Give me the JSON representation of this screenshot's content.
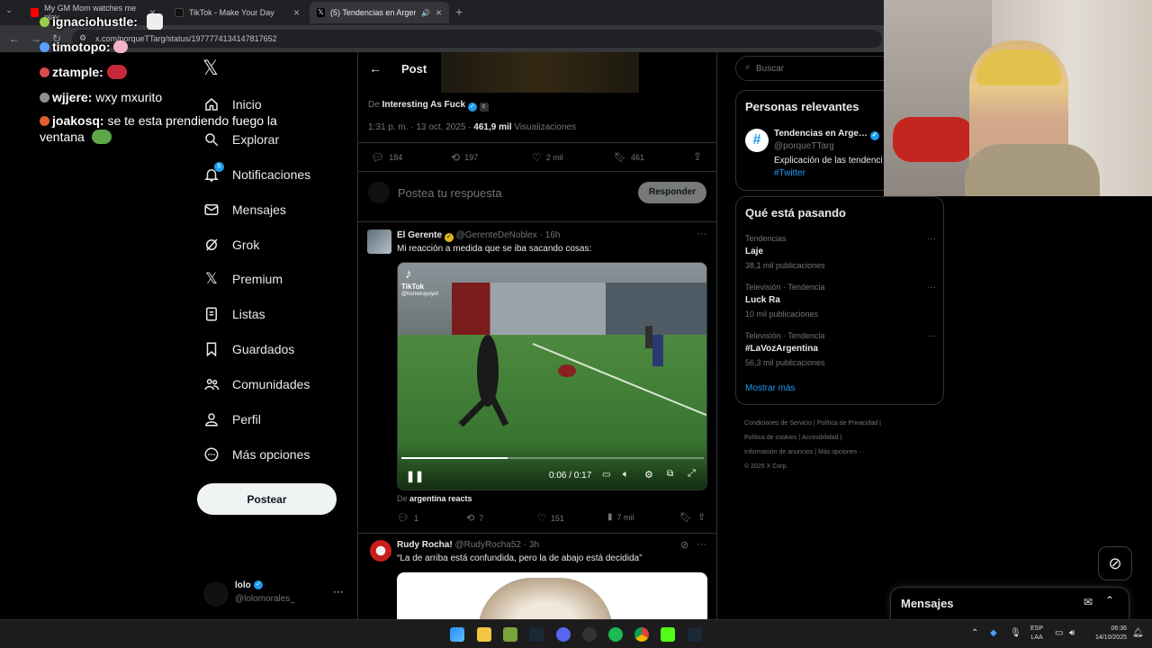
{
  "browser": {
    "tabs": [
      {
        "title": "My GM Mom watches me play",
        "active": false
      },
      {
        "title": "TikTok - Make Your Day",
        "active": false
      },
      {
        "title": "(5) Tendencias en Argentina",
        "active": true
      }
    ],
    "url": "x.com/porqueTTarg/status/1977774134147817652"
  },
  "chat": [
    {
      "user": "ignaciohustle:",
      "msg": "",
      "color": "#9ad14b"
    },
    {
      "user": "timotopo:",
      "msg": "",
      "color": "#5aa0ff"
    },
    {
      "user": "ztample:",
      "msg": "",
      "color": "#d94a4a"
    },
    {
      "user": "wjjere:",
      "msg": "wxy mxurito",
      "color": "#8f8f8f"
    },
    {
      "user": "joakosq:",
      "msg": "se te esta prendiendo fuego la",
      "msg2": "ventana",
      "color": "#e0612b"
    }
  ],
  "nav": {
    "logo": "X",
    "items": [
      {
        "label": "Inicio",
        "icon": "home-icon"
      },
      {
        "label": "Explorar",
        "icon": "search-icon"
      },
      {
        "label": "Notificaciones",
        "icon": "bell-icon",
        "badge": "5"
      },
      {
        "label": "Mensajes",
        "icon": "mail-icon"
      },
      {
        "label": "Grok",
        "icon": "grok-icon"
      },
      {
        "label": "Premium",
        "icon": "x-icon"
      },
      {
        "label": "Listas",
        "icon": "list-icon"
      },
      {
        "label": "Guardados",
        "icon": "bookmark-icon"
      },
      {
        "label": "Comunidades",
        "icon": "people-icon"
      },
      {
        "label": "Perfil",
        "icon": "person-icon"
      },
      {
        "label": "Más opciones",
        "icon": "more-circle-icon"
      }
    ],
    "post_button": "Postear",
    "account": {
      "name": "lolo",
      "handle": "@lolomorales_"
    }
  },
  "post": {
    "header": "Post",
    "source_prefix": "De",
    "source_name": "Interesting As Fuck",
    "time": "1:31 p. m. · 13 oct. 2025 · ",
    "views_count": "461,9 mil",
    "views_label": "Visualizaciones",
    "replies": "184",
    "reposts": "197",
    "likes": "2 mil",
    "bookmarks": "461",
    "reply_placeholder": "Postea tu respuesta",
    "reply_button": "Responder"
  },
  "reply1": {
    "name": "El Gerente",
    "handle": "@GerenteDeNoblex",
    "time": "16h",
    "text": "Mi reacción a medida que se iba sacando cosas:",
    "tiktok_label": "TikTok",
    "tiktok_user": "@homeropuyol",
    "video_time": "0:06 / 0:17",
    "progress": 0.35,
    "source_prefix": "De",
    "source_name": "argentina reacts",
    "replies": "1",
    "reposts": "7",
    "likes": "151",
    "views": "7 mil"
  },
  "reply2": {
    "name": "Rudy Rocha!",
    "handle": "@RudyRocha52",
    "time": "3h",
    "text": "“La de arriba está confundida, pero la de abajo está decidida”"
  },
  "right": {
    "search_placeholder": "Buscar",
    "relevant_title": "Personas relevantes",
    "relevant_name": "Tendencias en Arge…",
    "relevant_handle": "@porqueTTarg",
    "relevant_bio": "Explicación de las tendenci",
    "relevant_tag": "#Twitter",
    "trends_title": "Qué está pasando",
    "trends": [
      {
        "category": "Tendencias",
        "name": "Laje",
        "count": "38,1 mil publicaciones"
      },
      {
        "category": "Televisión · Tendencia",
        "name": "Luck Ra",
        "count": "10 mil publicaciones"
      },
      {
        "category": "Televisión · Tendencia",
        "name": "#LaVozArgentina",
        "count": "56,3 mil publicaciones"
      }
    ],
    "show_more": "Mostrar más",
    "footer": [
      "Condiciones de Servicio",
      "Política de Privacidad",
      "Política de cookies",
      "Accesibilidad",
      "Información de anuncios",
      "Más opciones ···",
      "© 2025 X Corp."
    ],
    "messages_title": "Mensajes"
  },
  "taskbar": {
    "lang": "ESP",
    "lang2": "LAA",
    "time": "06:36",
    "date": "14/10/2025"
  },
  "colors": {
    "accent": "#1d9bf0",
    "verified": "#1d9bf0",
    "gold_verified": "#e2b719"
  }
}
